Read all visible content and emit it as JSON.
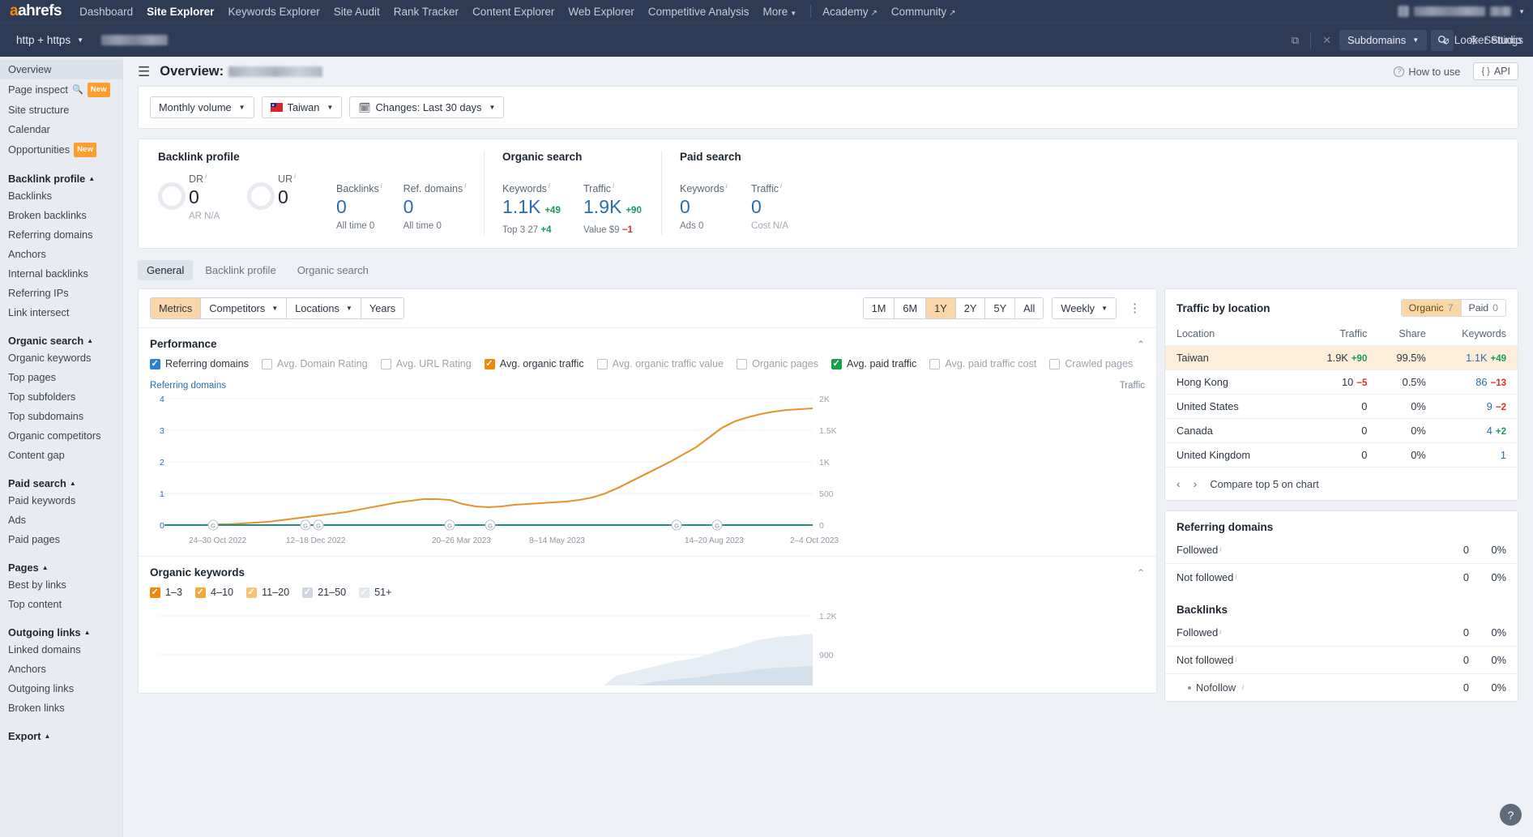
{
  "topnav": {
    "logo": "ahrefs",
    "items": [
      {
        "label": "Dashboard",
        "active": false
      },
      {
        "label": "Site Explorer",
        "active": true
      },
      {
        "label": "Keywords Explorer",
        "active": false
      },
      {
        "label": "Site Audit",
        "active": false
      },
      {
        "label": "Rank Tracker",
        "active": false
      },
      {
        "label": "Content Explorer",
        "active": false
      },
      {
        "label": "Web Explorer",
        "active": false
      },
      {
        "label": "Competitive Analysis",
        "active": false
      },
      {
        "label": "More",
        "active": false
      }
    ],
    "external": [
      {
        "label": "Academy"
      },
      {
        "label": "Community"
      }
    ]
  },
  "searchbar": {
    "protocol": "http + https",
    "url_value": "",
    "scope": "Subdomains",
    "settings": "Settings",
    "looker": "Looker Studio",
    "icons": {
      "open_external": "external-link-icon",
      "clear": "X",
      "search": "search-icon",
      "gear": "gear-icon",
      "looker": "looker-studio-icon"
    }
  },
  "sidebar": {
    "top_items": [
      {
        "label": "Overview",
        "selected": true
      },
      {
        "label": "Page inspect",
        "badge": "New",
        "search_icon": true
      },
      {
        "label": "Site structure"
      },
      {
        "label": "Calendar"
      },
      {
        "label": "Opportunities",
        "badge": "New"
      }
    ],
    "groups": [
      {
        "title": "Backlink profile",
        "items": [
          "Backlinks",
          "Broken backlinks",
          "Referring domains",
          "Anchors",
          "Internal backlinks",
          "Referring IPs",
          "Link intersect"
        ]
      },
      {
        "title": "Organic search",
        "items": [
          "Organic keywords",
          "Top pages",
          "Top subfolders",
          "Top subdomains",
          "Organic competitors",
          "Content gap"
        ]
      },
      {
        "title": "Paid search",
        "items": [
          "Paid keywords",
          "Ads",
          "Paid pages"
        ]
      },
      {
        "title": "Pages",
        "items": [
          "Best by links",
          "Top content"
        ]
      },
      {
        "title": "Outgoing links",
        "items": [
          "Linked domains",
          "Anchors",
          "Outgoing links",
          "Broken links"
        ]
      },
      {
        "title": "Export",
        "items": []
      }
    ]
  },
  "header": {
    "title_prefix": "Overview:",
    "how_to_use": "How to use",
    "api": "API"
  },
  "filters": [
    {
      "label": "Monthly volume",
      "caret": true,
      "icon": null
    },
    {
      "label": "Taiwan",
      "caret": true,
      "icon": "flag-taiwan-icon"
    },
    {
      "label": "Changes: Last 30 days",
      "caret": true,
      "icon": "calendar-icon"
    }
  ],
  "metrics": {
    "groups": [
      {
        "title": "Backlink profile",
        "cells": [
          {
            "label": "DR",
            "value": "0",
            "sub": "AR  N/A",
            "gauge": true,
            "dark": true,
            "sub_muted": true
          },
          {
            "label": "UR",
            "value": "0",
            "sub": "",
            "gauge": true,
            "dark": true
          },
          {
            "label": "Backlinks",
            "value": "0",
            "sub": "All time 0"
          },
          {
            "label": "Ref. domains",
            "value": "0",
            "sub": "All time 0"
          }
        ]
      },
      {
        "title": "Organic search",
        "cells": [
          {
            "label": "Keywords",
            "value": "1.1K",
            "delta": "+49",
            "delta_dir": "up",
            "sub_pre": "Top 3",
            "sub_val": "27",
            "sub_delta": "+4",
            "sub_delta_dir": "up"
          },
          {
            "label": "Traffic",
            "value": "1.9K",
            "delta": "+90",
            "delta_dir": "up",
            "sub_pre": "Value",
            "sub_val": "$9",
            "sub_delta": "−1",
            "sub_delta_dir": "down"
          }
        ]
      },
      {
        "title": "Paid search",
        "cells": [
          {
            "label": "Keywords",
            "value": "0",
            "sub": "Ads 0"
          },
          {
            "label": "Traffic",
            "value": "0",
            "sub": "Cost  N/A",
            "sub_muted": true
          }
        ]
      }
    ]
  },
  "tabs": [
    {
      "label": "General",
      "active": true
    },
    {
      "label": "Backlink profile",
      "active": false
    },
    {
      "label": "Organic search",
      "active": false
    }
  ],
  "chart_toolbar": {
    "left_group": [
      {
        "label": "Metrics",
        "selected": true,
        "caret": false
      },
      {
        "label": "Competitors",
        "selected": false,
        "caret": true
      },
      {
        "label": "Locations",
        "selected": false,
        "caret": true
      },
      {
        "label": "Years",
        "selected": false,
        "caret": false
      }
    ],
    "ranges": [
      {
        "label": "1M",
        "selected": false
      },
      {
        "label": "6M",
        "selected": false
      },
      {
        "label": "1Y",
        "selected": true
      },
      {
        "label": "2Y",
        "selected": false
      },
      {
        "label": "5Y",
        "selected": false
      },
      {
        "label": "All",
        "selected": false
      }
    ],
    "granularity": "Weekly",
    "kebab": "more-options-icon"
  },
  "performance": {
    "title": "Performance",
    "checkboxes": [
      {
        "label": "Referring domains",
        "checked": true,
        "color": "blue"
      },
      {
        "label": "Avg. Domain Rating",
        "checked": false,
        "color": "blue"
      },
      {
        "label": "Avg. URL Rating",
        "checked": false,
        "color": "blue"
      },
      {
        "label": "Avg. organic traffic",
        "checked": true,
        "color": "orange"
      },
      {
        "label": "Avg. organic traffic value",
        "checked": false,
        "color": "orange"
      },
      {
        "label": "Organic pages",
        "checked": false,
        "color": "green"
      },
      {
        "label": "Avg. paid traffic",
        "checked": true,
        "color": "green"
      },
      {
        "label": "Avg. paid traffic cost",
        "checked": false,
        "color": "green"
      },
      {
        "label": "Crawled pages",
        "checked": false,
        "color": "blue"
      }
    ],
    "axis_left_label": "Referring domains",
    "axis_right_label": "Traffic"
  },
  "organic_keywords": {
    "title": "Organic keywords",
    "buckets": [
      {
        "label": "1–3",
        "checked": true,
        "color": "o1"
      },
      {
        "label": "4–10",
        "checked": true,
        "color": "o2"
      },
      {
        "label": "11–20",
        "checked": true,
        "color": "o3"
      },
      {
        "label": "21–50",
        "checked": true,
        "color": "o4"
      },
      {
        "label": "51+",
        "checked": true,
        "color": "o5"
      }
    ]
  },
  "traffic_by_location": {
    "title": "Traffic by location",
    "segments": [
      {
        "label": "Organic",
        "count": "7",
        "selected": true
      },
      {
        "label": "Paid",
        "count": "0",
        "selected": false
      }
    ],
    "columns": [
      "Location",
      "Traffic",
      "Share",
      "Keywords"
    ],
    "rows": [
      {
        "location": "Taiwan",
        "traffic": "1.9K",
        "traffic_delta": "+90",
        "traffic_dir": "up",
        "share": "99.5%",
        "keywords": "1.1K",
        "keywords_delta": "+49",
        "keywords_dir": "up",
        "highlight": true
      },
      {
        "location": "Hong Kong",
        "traffic": "10",
        "traffic_delta": "−5",
        "traffic_dir": "down",
        "share": "0.5%",
        "keywords": "86",
        "keywords_delta": "−13",
        "keywords_dir": "down",
        "highlight": false
      },
      {
        "location": "United States",
        "traffic": "0",
        "traffic_delta": "",
        "traffic_dir": "",
        "share": "0%",
        "keywords": "9",
        "keywords_delta": "−2",
        "keywords_dir": "down",
        "highlight": false
      },
      {
        "location": "Canada",
        "traffic": "0",
        "traffic_delta": "",
        "traffic_dir": "",
        "share": "0%",
        "keywords": "4",
        "keywords_delta": "+2",
        "keywords_dir": "up",
        "highlight": false
      },
      {
        "location": "United Kingdom",
        "traffic": "0",
        "traffic_delta": "",
        "traffic_dir": "",
        "share": "0%",
        "keywords": "1",
        "keywords_delta": "",
        "keywords_dir": "",
        "highlight": false
      }
    ],
    "compare_label": "Compare top 5 on chart"
  },
  "referring_domains_panel": {
    "title": "Referring domains",
    "rows": [
      {
        "label": "Followed",
        "info": true,
        "value": "0",
        "pct": "0%"
      },
      {
        "label": "Not followed",
        "info": true,
        "value": "0",
        "pct": "0%"
      }
    ]
  },
  "backlinks_panel": {
    "title": "Backlinks",
    "rows": [
      {
        "label": "Followed",
        "info": true,
        "value": "0",
        "pct": "0%",
        "sub": false
      },
      {
        "label": "Not followed",
        "info": true,
        "value": "0",
        "pct": "0%",
        "sub": false
      },
      {
        "label": "Nofollow",
        "info": true,
        "value": "0",
        "pct": "0%",
        "sub": true
      }
    ]
  },
  "help_fab": "?",
  "chart_data": {
    "type": "line",
    "title": "Performance",
    "xlabel": "",
    "ylabel_left": "Referring domains",
    "ylabel_right": "Traffic",
    "x_tick_labels": [
      "24–30 Oct 2022",
      "12–18 Dec 2022",
      "20–26 Mar 2023",
      "8–14 May 2023",
      "14–20 Aug 2023",
      "2–4 Oct 2023"
    ],
    "y_left_ticks": [
      0,
      1,
      2,
      3,
      4
    ],
    "y_right_ticks": [
      0,
      500,
      1000,
      1500,
      2000
    ],
    "y_right_tick_labels": [
      "0",
      "500",
      "1K",
      "1.5K",
      "2K"
    ],
    "ylim_left": [
      0,
      4
    ],
    "ylim_right": [
      0,
      2000
    ],
    "grid": true,
    "legend_position": "inline-checkboxes",
    "series": [
      {
        "name": "Avg. organic traffic",
        "color": "#e8912d",
        "axis": "right",
        "values": [
          5,
          6,
          6,
          7,
          8,
          10,
          12,
          15,
          20,
          30,
          45,
          60,
          80,
          110,
          150,
          180,
          200,
          240,
          300,
          330,
          300,
          280,
          270,
          280,
          300,
          320,
          350,
          400,
          450,
          520,
          560,
          600,
          640,
          700,
          760,
          900,
          1050,
          1250,
          1400,
          1500,
          1570,
          1620,
          1680,
          1750,
          1800,
          1850,
          1900,
          1930,
          1950,
          1960,
          1965,
          1970
        ]
      },
      {
        "name": "Avg. paid traffic",
        "color": "#17a04a",
        "axis": "right",
        "values": [
          0,
          0,
          0,
          0,
          0,
          0,
          0,
          0,
          0,
          0,
          0,
          0,
          0,
          0,
          0,
          0,
          0,
          0,
          0,
          0,
          0,
          0,
          0,
          0,
          0,
          0,
          0,
          0,
          0,
          0,
          0,
          0,
          0,
          0,
          0,
          0,
          0,
          0,
          0,
          0,
          0,
          0,
          0,
          0,
          0,
          0,
          0,
          0,
          0,
          0,
          0,
          0
        ]
      },
      {
        "name": "Referring domains",
        "color": "#2b7fd4",
        "axis": "left",
        "values": [
          0,
          0,
          0,
          0,
          0,
          0,
          0,
          0,
          0,
          0,
          0,
          0,
          0,
          0,
          0,
          0,
          0,
          0,
          0,
          0,
          0,
          0,
          0,
          0,
          0,
          0,
          0,
          0,
          0,
          0,
          0,
          0,
          0,
          0,
          0,
          0,
          0,
          0,
          0,
          0,
          0,
          0,
          0,
          0,
          0,
          0,
          0,
          0,
          0,
          0,
          0,
          0
        ]
      }
    ],
    "annotations": [
      {
        "label": "G",
        "type": "google-update-marker",
        "x_index": 4
      },
      {
        "label": "G",
        "type": "google-update-marker",
        "x_index": 10
      },
      {
        "label": "G",
        "type": "google-update-marker",
        "x_index": 12
      },
      {
        "label": "G",
        "type": "google-update-marker",
        "x_index": 22
      },
      {
        "label": "G",
        "type": "google-update-marker",
        "x_index": 25
      },
      {
        "label": "G",
        "type": "google-update-marker",
        "x_index": 40
      },
      {
        "label": "G",
        "type": "google-update-marker",
        "x_index": 43
      }
    ]
  },
  "organic_keywords_chart": {
    "type": "area",
    "y_right_tick_labels": [
      "1.2K",
      "900"
    ],
    "series": [
      {
        "name": "51+",
        "color": "#e7edf5"
      },
      {
        "name": "21–50",
        "color": "#d4dfec"
      }
    ]
  }
}
